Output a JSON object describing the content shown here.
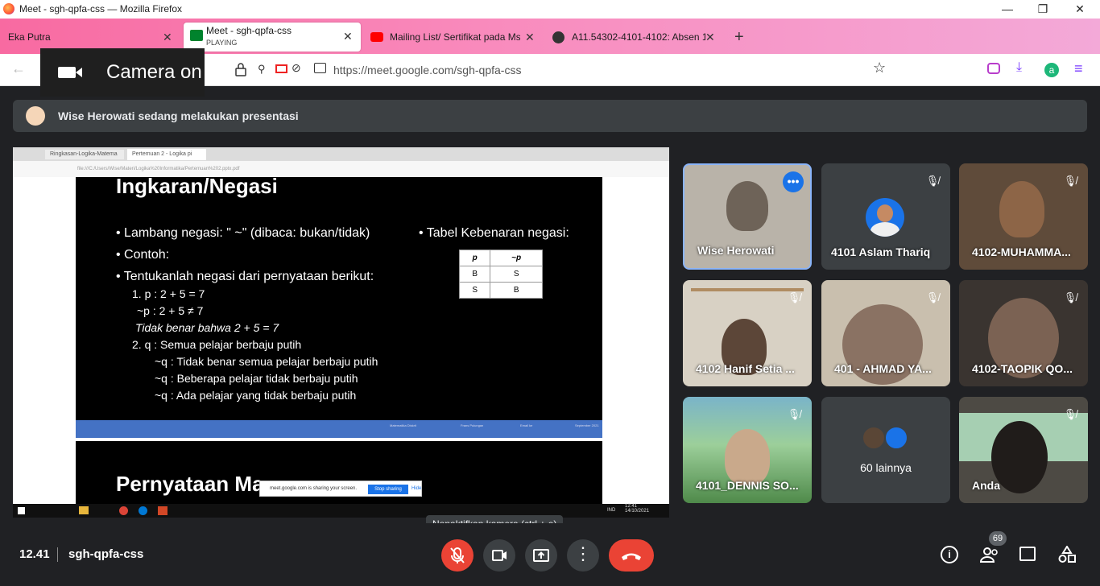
{
  "window": {
    "title": "Meet - sgh-qpfa-css — Mozilla Firefox"
  },
  "tabs": [
    {
      "label": "Eka Putra"
    },
    {
      "label": "Meet - sgh-qpfa-css",
      "sub": "PLAYING"
    },
    {
      "label": "Mailing List/ Sertifikat pada Ms"
    },
    {
      "label": "A11.54302-4101-4102: Absen 14"
    }
  ],
  "camera_toast": {
    "label": "Camera on"
  },
  "url": "https://meet.google.com/sgh-qpfa-css",
  "presenter": {
    "text": "Wise Herowati sedang melakukan presentasi"
  },
  "slide": {
    "edge_tabs": [
      "Ringkasan-Logika-Matema",
      "Pertemuan 2 - Logika pi"
    ],
    "edge_url": "file:///C:/Users/Wise/Materi/Logika%20Informatika/Pertemuan%202.pptx.pdf",
    "title": "Ingkaran/Negasi",
    "bullets": [
      "Lambang negasi: \" ~\" (dibaca: bukan/tidak)",
      "Contoh:",
      "Tentukanlah negasi dari pernyataan berikut:"
    ],
    "table_title": "Tabel Kebenaran negasi:",
    "table": {
      "headers": [
        "p",
        "~p"
      ],
      "rows": [
        [
          "B",
          "S"
        ],
        [
          "S",
          "B"
        ]
      ]
    },
    "lines": [
      "1.     p : 2 + 5 = 7",
      "~p : 2 +  5 ≠ 7",
      "Tidak benar bahwa 2 + 5 = 7",
      "2.     q : Semua pelajar berbaju putih",
      "~q : Tidak benar semua pelajar berbaju putih",
      "~q : Beberapa pelajar tidak berbaju putih",
      "~q : Ada pelajar yang tidak berbaju putih"
    ],
    "footer": [
      "Matematika Diskrit",
      "Frans Pulungan",
      "Email ke",
      "September 2021"
    ],
    "next_title": "Pernyataan Ma",
    "share_bar": {
      "text": "meet.google.com is sharing your screen.",
      "stop": "Stop sharing",
      "hide": "Hide"
    },
    "taskbar": {
      "time": "12:41",
      "date": "14/10/2021",
      "lang": "IND"
    }
  },
  "participants": [
    {
      "name": "Wise Herowati"
    },
    {
      "name": "4101 Aslam Thariq"
    },
    {
      "name": "4102-MUHAMMA..."
    },
    {
      "name": "4102 Hanif Setia ..."
    },
    {
      "name": "401 - AHMAD YA..."
    },
    {
      "name": "4102-TAOPIK QO..."
    },
    {
      "name": "4101_DENNIS SO..."
    },
    {
      "name": "60 lainnya"
    },
    {
      "name": "Anda"
    }
  ],
  "bottom": {
    "time": "12.41",
    "meeting_code": "sgh-qpfa-css",
    "tooltip": "Nonaktifkan kamera (ctrl + e)",
    "people_count": "69"
  },
  "colors": {
    "end_call": "#ea4335",
    "mic_off": "#ea4335",
    "active_tile": "#8ab4f8",
    "avatar_blue": "#1a73e8"
  }
}
